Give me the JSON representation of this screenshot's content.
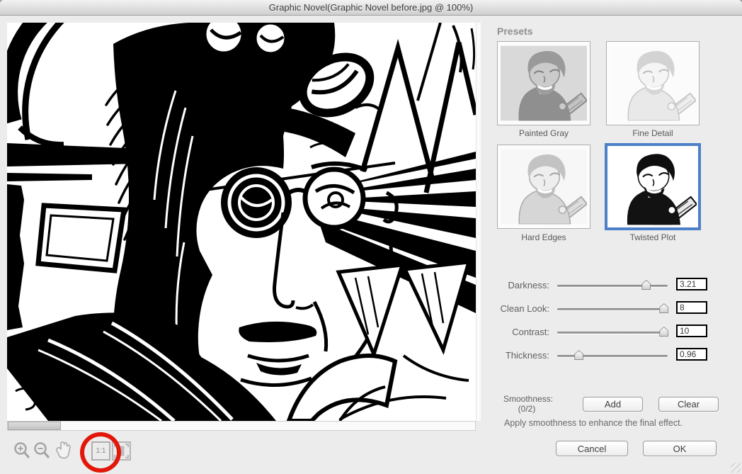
{
  "window": {
    "title": "Graphic Novel(Graphic Novel before.jpg @ 100%)"
  },
  "toolbar": {
    "zoom_ratio_label": "1:1",
    "icons": [
      "zoom-in-icon",
      "zoom-out-icon",
      "hand-icon",
      "actual-size-icon",
      "fit-view-icon"
    ]
  },
  "annotation": {
    "shape": "ellipse",
    "color": "#e2170a",
    "target": "actual-size-button"
  },
  "presets": {
    "heading": "Presets",
    "selected_border_color": "#4d80c7",
    "items": [
      {
        "label": "Painted Gray",
        "selected": false
      },
      {
        "label": "Fine Detail",
        "selected": false
      },
      {
        "label": "Hard Edges",
        "selected": false
      },
      {
        "label": "Twisted Plot",
        "selected": true
      }
    ]
  },
  "sliders": [
    {
      "label": "Darkness:",
      "value": "3.21",
      "position_pct": 81
    },
    {
      "label": "Clean Look:",
      "value": "8",
      "position_pct": 97
    },
    {
      "label": "Contrast:",
      "value": "10",
      "position_pct": 97
    },
    {
      "label": "Thickness:",
      "value": "0.96",
      "position_pct": 20
    }
  ],
  "smoothness": {
    "label": "Smoothness:",
    "counter": "(0/2)",
    "add_label": "Add",
    "clear_label": "Clear",
    "hint": "Apply smoothness to enhance the final effect."
  },
  "footer": {
    "cancel_label": "Cancel",
    "ok_label": "OK"
  }
}
